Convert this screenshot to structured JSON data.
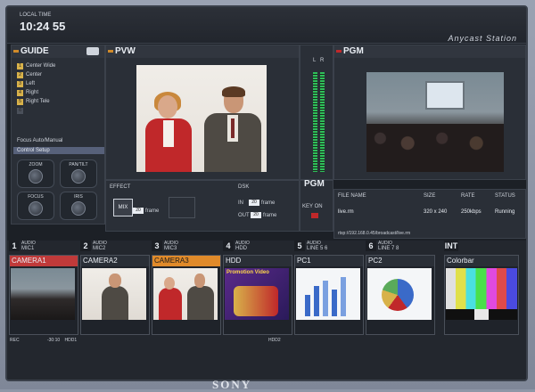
{
  "topbar": {
    "time_label": "LOCAL TIME",
    "time": "10:24 55",
    "brand": "Anycast Station"
  },
  "guide": {
    "title": "GUIDE",
    "items": [
      {
        "num": "1",
        "label": "Center Wide"
      },
      {
        "num": "2",
        "label": "Center"
      },
      {
        "num": "3",
        "label": "Left"
      },
      {
        "num": "4",
        "label": "Right"
      },
      {
        "num": "5",
        "label": "Right Tele"
      },
      {
        "num": "6",
        "label": ""
      }
    ],
    "focus_am": "Focus Auto/Manual",
    "control_setup": "Control Setup",
    "knobs": {
      "zoom": "ZOOM",
      "pantilt": "PAN/TILT",
      "focus": "FOCUS",
      "iris": "IRIS"
    }
  },
  "pvw": {
    "title": "PVW"
  },
  "meters": {
    "l": "L",
    "r": "R"
  },
  "pgm": {
    "title": "PGM",
    "label2": "PGM",
    "key_on": "KEY ON"
  },
  "effect": {
    "label": "EFFECT",
    "mix": "MIX",
    "frames": "20",
    "frame_word": "frame"
  },
  "dsk": {
    "label": "DSK",
    "in_label": "IN",
    "in_value": "20",
    "out_label": "OUT",
    "out_value": "20",
    "frame_word": "frame"
  },
  "stream": {
    "headers": {
      "file": "FILE NAME",
      "size": "SIZE",
      "rate": "RATE",
      "status": "STATUS"
    },
    "file": "live.rm",
    "size": "320 x 240",
    "rate": "250kbps",
    "status": "Running",
    "url": "rtsp://192.168.0.45/broadcast/live.rm"
  },
  "sources": [
    {
      "num": "1",
      "audio": "AUDIO",
      "mic": "MIC1",
      "label": "CAMERA1",
      "style": "red",
      "rec": "REC",
      "time": "-30:10",
      "sub": "HDD1"
    },
    {
      "num": "2",
      "audio": "AUDIO",
      "mic": "MIC2",
      "label": "CAMERA2",
      "style": "",
      "rec": "",
      "time": "",
      "sub": ""
    },
    {
      "num": "3",
      "audio": "AUDIO",
      "mic": "MIC3",
      "label": "CAMERA3",
      "style": "orange",
      "rec": "",
      "time": "",
      "sub": ""
    },
    {
      "num": "4",
      "audio": "AUDIO",
      "mic": "HDD",
      "label": "HDD",
      "style": "",
      "rec": "",
      "time": "",
      "sub": "HDD2",
      "promo": "Promotion Video"
    },
    {
      "num": "5",
      "audio": "AUDIO",
      "mic": "LINE 5 6",
      "label": "PC1",
      "style": "",
      "rec": "",
      "time": "",
      "sub": ""
    },
    {
      "num": "6",
      "audio": "AUDIO",
      "mic": "LINE 7 8",
      "label": "PC2",
      "style": "",
      "rec": "",
      "time": "",
      "sub": ""
    },
    {
      "num": "",
      "audio": "",
      "mic": "",
      "label": "Colorbar",
      "style": "",
      "rec": "",
      "time": "",
      "sub": "",
      "int": "INT"
    }
  ],
  "bezel": {
    "brand": "SONY"
  }
}
